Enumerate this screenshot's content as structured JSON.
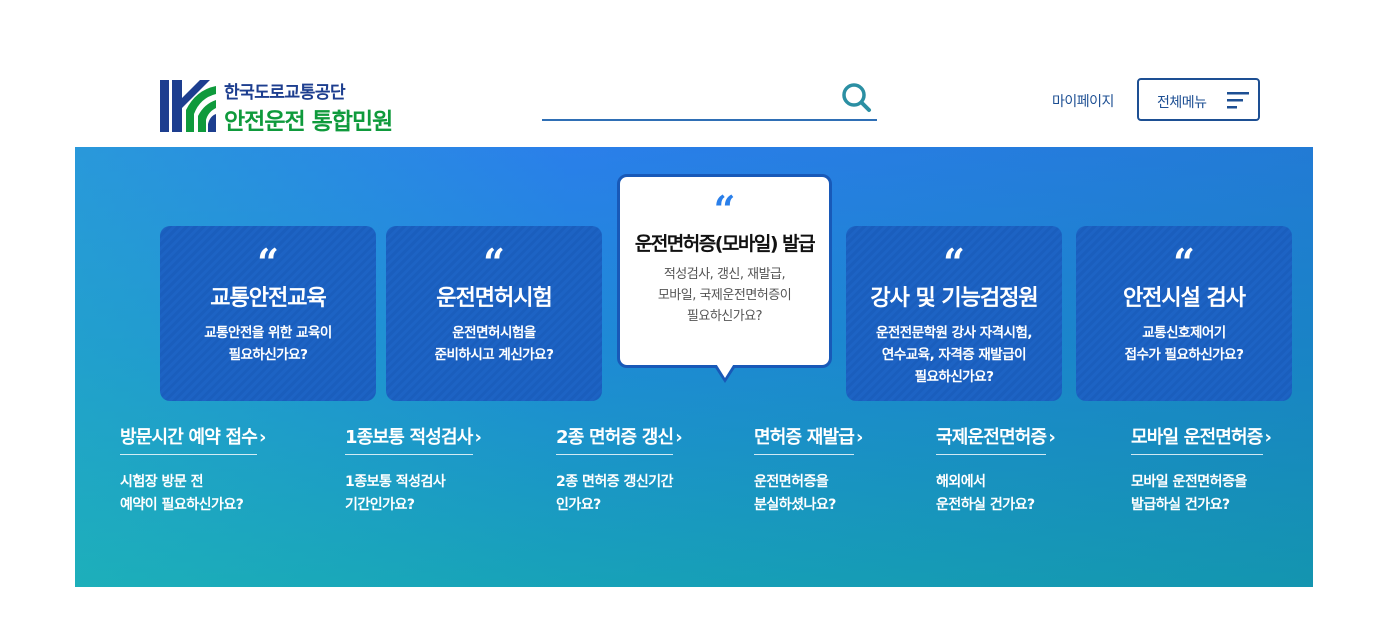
{
  "header": {
    "org_name": "한국도로교통공단",
    "site_title": "안전운전 통합민원",
    "search_placeholder": "",
    "mypage_label": "마이페이지",
    "allmenu_label": "전체메뉴"
  },
  "colors": {
    "brand_blue": "#1d4f93",
    "brand_green": "#0f9a3c",
    "banner_top": "#2a7fea",
    "banner_bottom": "#17a2b8"
  },
  "icons": {
    "logo": "kk-logo-mark",
    "search": "search-icon",
    "menu": "hamburger-icon",
    "quote": "quote-icon",
    "chevron": "chevron-right-icon"
  },
  "cards": [
    {
      "quote": "“",
      "title": "교통안전교육",
      "desc_line1": "교통안전을 위한 교육이",
      "desc_line2": "필요하신가요?",
      "desc_line3": ""
    },
    {
      "quote": "“",
      "title": "운전면허시험",
      "desc_line1": "운전면허시험을",
      "desc_line2": "준비하시고 계신가요?",
      "desc_line3": ""
    },
    {
      "quote": "“",
      "title": "운전면허증(모바일) 발급",
      "desc_line1": "적성검사, 갱신, 재발급,",
      "desc_line2": "모바일, 국제운전면허증이",
      "desc_line3": "필요하신가요?"
    },
    {
      "quote": "“",
      "title": "강사 및 기능검정원",
      "desc_line1": "운전전문학원 강사 자격시험,",
      "desc_line2": "연수교육, 자격증 재발급이",
      "desc_line3": "필요하신가요?"
    },
    {
      "quote": "“",
      "title": "안전시설 검사",
      "desc_line1": "교통신호제어기",
      "desc_line2": "접수가 필요하신가요?",
      "desc_line3": ""
    }
  ],
  "quick_links": [
    {
      "title": "방문시간 예약 접수",
      "chevron": "›",
      "desc_line1": "시험장 방문 전",
      "desc_line2": "예약이 필요하신가요?"
    },
    {
      "title": "1종보통 적성검사",
      "chevron": "›",
      "desc_line1": "1종보통 적성검사",
      "desc_line2": "기간인가요?"
    },
    {
      "title": "2종 면허증 갱신",
      "chevron": "›",
      "desc_line1": "2종 면허증 갱신기간",
      "desc_line2": "인가요?"
    },
    {
      "title": "면허증 재발급",
      "chevron": "›",
      "desc_line1": "운전면허증을",
      "desc_line2": "분실하셨나요?"
    },
    {
      "title": "국제운전면허증",
      "chevron": "›",
      "desc_line1": "해외에서",
      "desc_line2": "운전하실 건가요?"
    },
    {
      "title": "모바일 운전면허증",
      "chevron": "›",
      "desc_line1": "모바일 운전면허증을",
      "desc_line2": "발급하실 건가요?"
    }
  ]
}
